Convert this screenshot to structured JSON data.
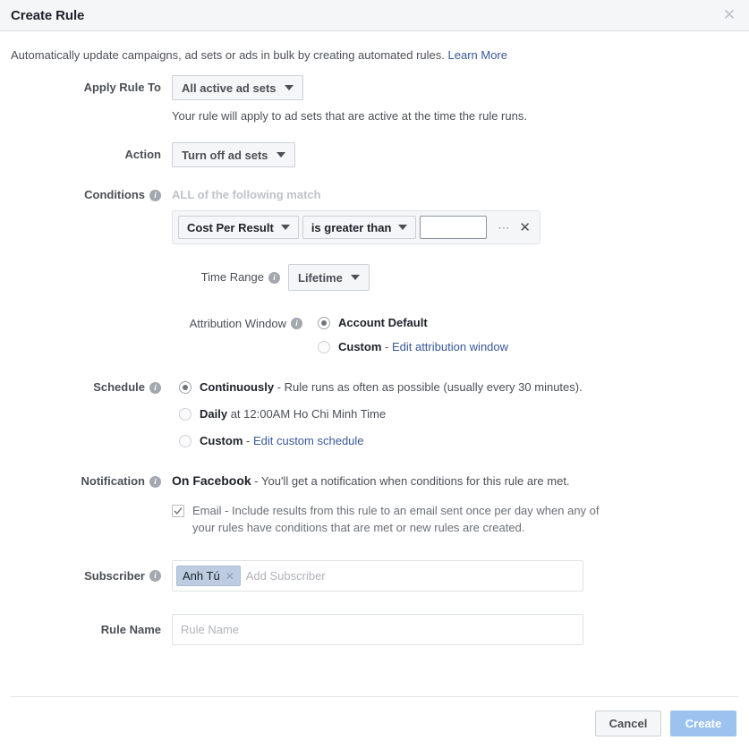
{
  "dialog": {
    "title": "Create Rule",
    "close_icon": "close-icon",
    "intro_text": "Automatically update campaigns, ad sets or ads in bulk by creating automated rules.",
    "intro_link": "Learn More"
  },
  "apply_rule_to": {
    "label": "Apply Rule To",
    "value": "All active ad sets",
    "help_text": "Your rule will apply to ad sets that are active at the time the rule runs."
  },
  "action": {
    "label": "Action",
    "value": "Turn off ad sets"
  },
  "conditions": {
    "label": "Conditions",
    "info_icon": "info-icon",
    "match_text": "ALL of the following match",
    "rows": [
      {
        "metric": "Cost Per Result",
        "operator": "is greater than",
        "value": "",
        "value_placeholder": "",
        "more_icon": "ellipsis-icon",
        "remove_icon": "close-icon"
      }
    ]
  },
  "time_range": {
    "label": "Time Range",
    "info_icon": "info-icon",
    "value": "Lifetime"
  },
  "attribution_window": {
    "label": "Attribution Window",
    "info_icon": "info-icon",
    "options": [
      {
        "label": "Account Default",
        "selected": true,
        "suffix": "",
        "link": ""
      },
      {
        "label": "Custom",
        "selected": false,
        "suffix": " - ",
        "link": "Edit attribution window"
      }
    ]
  },
  "schedule": {
    "label": "Schedule",
    "info_icon": "info-icon",
    "options": [
      {
        "label": "Continuously",
        "selected": true,
        "suffix": " - Rule runs as often as possible (usually every 30 minutes).",
        "link": ""
      },
      {
        "label": "Daily",
        "selected": false,
        "suffix": " at 12:00AM Ho Chi Minh Time",
        "link": ""
      },
      {
        "label": "Custom",
        "selected": false,
        "suffix": " - ",
        "link": "Edit custom schedule"
      }
    ]
  },
  "notification": {
    "label": "Notification",
    "info_icon": "info-icon",
    "facebook_strong": "On Facebook",
    "facebook_text": " - You'll get a notification when conditions for this rule are met.",
    "email_checked": true,
    "email_text": "Email - Include results from this rule to an email sent once per day when any of your rules have conditions that are met or new rules are created."
  },
  "subscriber": {
    "label": "Subscriber",
    "info_icon": "info-icon",
    "tokens": [
      {
        "name": "Anh Tú",
        "remove_icon": "close-icon"
      }
    ],
    "placeholder": "Add Subscriber"
  },
  "rule_name": {
    "label": "Rule Name",
    "value": "",
    "placeholder": "Rule Name"
  },
  "footer": {
    "cancel_label": "Cancel",
    "create_label": "Create",
    "create_disabled": true
  },
  "colors": {
    "link": "#385898",
    "header_bg": "#f5f6f7",
    "primary_disabled": "#9cc3f0",
    "token_bg": "#bdcce0",
    "muted_text": "#bec3c9"
  }
}
